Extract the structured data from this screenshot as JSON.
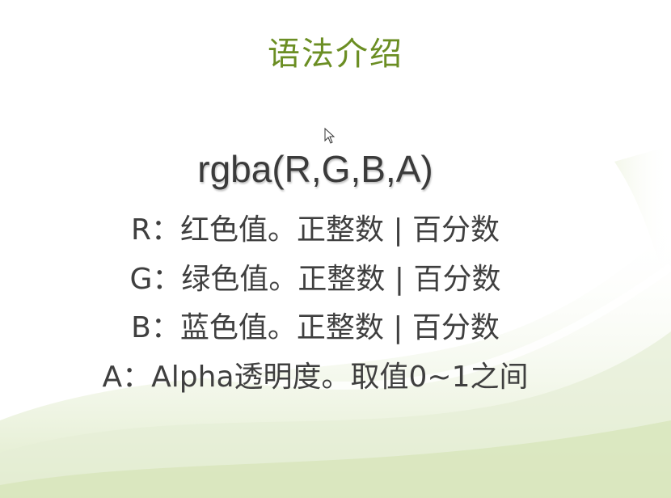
{
  "slide": {
    "title": "语法介绍",
    "syntax": "rgba(R,G,B,A)",
    "lines": [
      "R：红色值。正整数 | 百分数",
      "G：绿色值。正整数 | 百分数",
      "B：蓝色值。正整数 | 百分数",
      "A：Alpha透明度。取值0~1之间"
    ]
  },
  "colors": {
    "title": "#6b8e23",
    "text": "#3f3f3f",
    "background_accent": "#dfe9c8"
  },
  "icons": {
    "cursor": "mouse-pointer-icon"
  }
}
